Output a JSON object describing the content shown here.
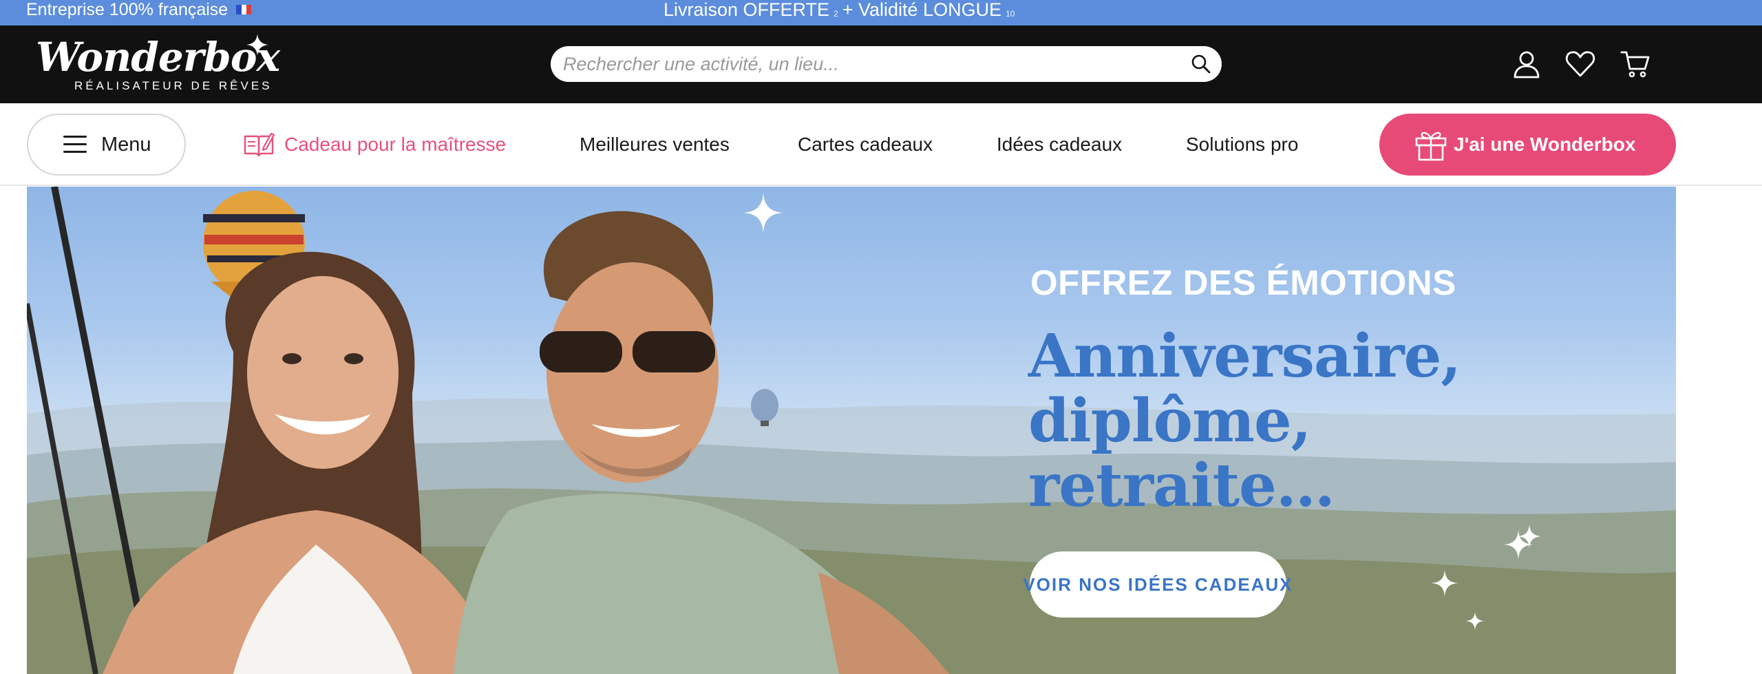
{
  "promo_bar": {
    "left_text": "Entreprise 100% française",
    "offer_part1": "Livraison OFFERTE",
    "offer_sup1": "2",
    "offer_part2": "+ Validité LONGUE",
    "offer_sup2": "10",
    "background_color": "#5b8ddc"
  },
  "header": {
    "logo_text": "Wonderbox",
    "logo_tagline": "RÉALISATEUR DE RÊVES",
    "search_placeholder": "Rechercher une activité, un lieu...",
    "icons": [
      "search-icon",
      "account-icon",
      "heart-icon",
      "cart-icon"
    ]
  },
  "nav": {
    "menu_label": "Menu",
    "highlight_link": "Cadeau pour la maîtresse",
    "links": [
      "Meilleures ventes",
      "Cartes cadeaux",
      "Idées cadeaux",
      "Solutions pro"
    ],
    "cta_label": "J'ai une Wonderbox",
    "accent_color": "#e84a78"
  },
  "hero": {
    "kicker": "OFFREZ DES ÉMOTIONS",
    "headline_lines": [
      "Anniversaire,",
      "diplôme,",
      "retraite…"
    ],
    "cta_label": "VOIR NOS IDÉES CADEAUX",
    "headline_color": "#3a75c6"
  }
}
